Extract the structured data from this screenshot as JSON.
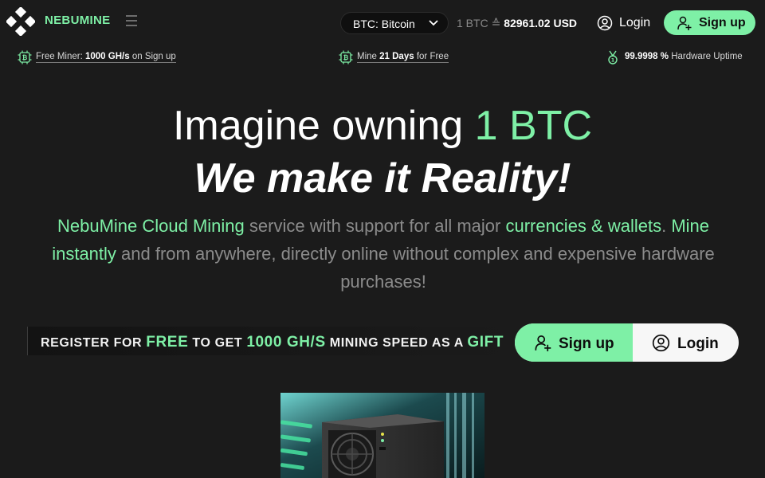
{
  "header": {
    "brand": "NEBUMINE",
    "coin_select": {
      "selected": "BTC: Bitcoin"
    },
    "price": {
      "unit": "1 BTC ≙",
      "value": "82961.02 USD"
    },
    "login_label": "Login",
    "signup_label": "Sign up"
  },
  "info_bar": {
    "free_miner": {
      "prefix": "Free Miner:",
      "value": "1000 GH/s",
      "suffix": "on Sign up"
    },
    "mine_days": {
      "prefix": "Mine",
      "value": "21 Days",
      "suffix": "for Free"
    },
    "uptime": {
      "value": "99.9998 %",
      "suffix": "Hardware Uptime"
    }
  },
  "hero": {
    "title_plain": "Imagine owning",
    "title_highlight": "1 BTC",
    "subtitle": "We make it Reality!",
    "desc": {
      "p1": "NebuMine Cloud Mining",
      "p2": " service with support for all major ",
      "p3": "currencies & wallets",
      "p4": ". ",
      "p5": "Mine instantly",
      "p6": " and from anywhere, directly online without complex and expensive hardware purchases!"
    }
  },
  "register": {
    "a": "REGISTER FOR ",
    "b": "FREE",
    "c": " TO GET ",
    "d": "1000 GH/S",
    "e": " MINING SPEED AS A ",
    "f": "GIFT"
  },
  "cta": {
    "signup_label": "Sign up",
    "login_label": "Login"
  },
  "icons": {
    "logo": "nebumine-logo-icon",
    "menu": "hamburger-menu-icon",
    "chevron": "chevron-down-icon",
    "user": "user-circle-icon",
    "user_plus": "user-plus-icon",
    "bitcoin_chip": "bitcoin-chip-icon",
    "medal": "medal-icon"
  },
  "colors": {
    "accent": "#7ef0a6",
    "background": "#1b1b1b",
    "muted_text": "#8b8b8b",
    "button_light": "#f7f7f7"
  }
}
